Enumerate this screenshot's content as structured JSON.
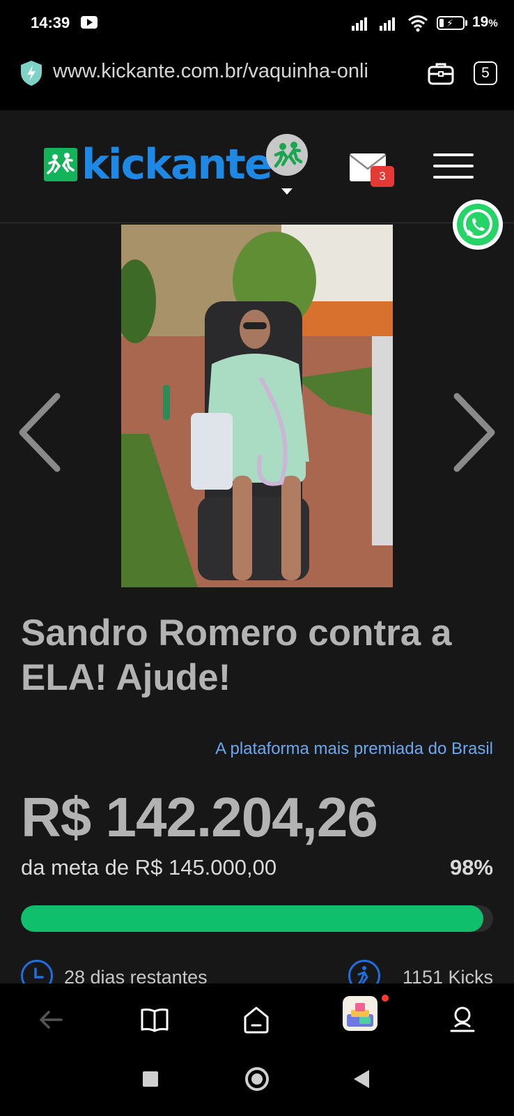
{
  "status_bar": {
    "time": "14:39",
    "battery_percent": "19",
    "battery_unit": "%",
    "icons": [
      "youtube-icon",
      "signal-icon",
      "signal-icon",
      "wifi-icon",
      "battery-charging-icon"
    ]
  },
  "browser": {
    "url": "www.kickante.com.br/vaquinha-onli",
    "tab_count": "5",
    "icons": [
      "shield-bolt-icon",
      "briefcase-icon"
    ]
  },
  "site_header": {
    "logo_text": "kickante",
    "mail_unread_count": "3",
    "icons": [
      "kickante-logo-icon",
      "profile-avatar",
      "caret-down-icon",
      "mail-icon",
      "hamburger-menu-icon",
      "whatsapp-icon"
    ]
  },
  "campaign": {
    "title": "Sandro Romero contra a ELA! Ajude!",
    "platform_tagline": "A plataforma mais premiada do Brasil",
    "amount_raised": "R$ 142.204,26",
    "goal_text": "da meta de R$ 145.000,00",
    "goal_percent": "98%",
    "progress_fraction": 0.98,
    "days_remaining": "28 dias restantes",
    "kicks": "1151 Kicks",
    "photo_description_icon": "campaign-photo"
  },
  "browser_toolbar": {
    "icons": [
      "back-arrow-icon",
      "book-icon",
      "home-icon",
      "games-icon",
      "account-icon"
    ]
  },
  "system_nav": {
    "icons": [
      "recents-square-icon",
      "home-circle-icon",
      "back-triangle-icon"
    ]
  },
  "colors": {
    "page_bg": "#171717",
    "brand_blue": "#1e88e5",
    "brand_green": "#12b35a",
    "progress_green": "#0fbf6b",
    "link_blue": "#6aa8f2",
    "badge_red": "#e53935"
  }
}
